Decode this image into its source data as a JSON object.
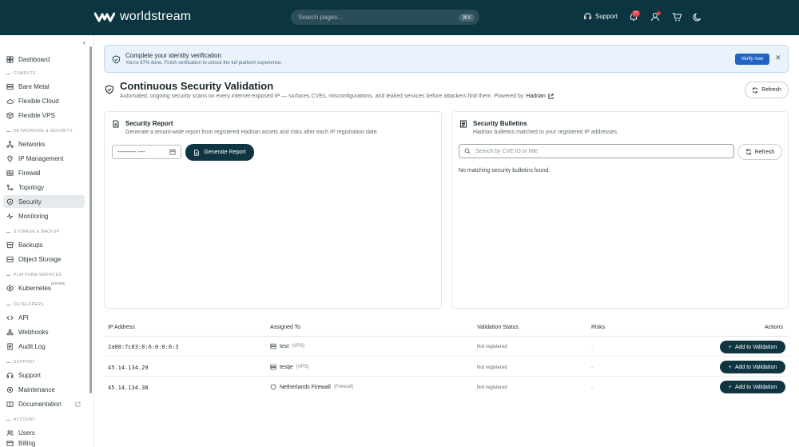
{
  "header": {
    "logo_text": "worldstream",
    "search_placeholder": "Search pages...",
    "search_shortcut": "⌘K",
    "support_label": "Support",
    "notification_count": "27"
  },
  "sidebar": {
    "items": {
      "dashboard": "Dashboard",
      "bare_metal": "Bare Metal",
      "flexible_cloud": "Flexible Cloud",
      "flexible_vps": "Flexible VPS",
      "networks": "Networks",
      "ip_management": "IP Management",
      "firewall": "Firewall",
      "topology": "Topology",
      "security": "Security",
      "monitoring": "Monitoring",
      "backups": "Backups",
      "object_storage": "Object Storage",
      "kubernetes": "Kubernetes",
      "api": "API",
      "webhooks": "Webhooks",
      "audit_log": "Audit Log",
      "support": "Support",
      "maintenance": "Maintenance",
      "documentation": "Documentation",
      "users": "Users",
      "billing": "Billing"
    },
    "sections": {
      "compute": "COMPUTE",
      "networking": "NETWORKING & SECURITY",
      "storage": "STORAGE & BACKUP",
      "platform": "PLATFORM SERVICES",
      "developers": "DEVELOPERS",
      "support": "SUPPORT",
      "account": "ACCOUNT"
    },
    "preview_tag": "preview"
  },
  "banner": {
    "title": "Complete your identity verification",
    "subtitle": "You're 67% done. Finish verification to unlock the full platform experience.",
    "verify_label": "Verify now"
  },
  "page": {
    "title": "Continuous Security Validation",
    "subtitle": "Automated, ongoing security scans on every internet-exposed IP — surfaces CVEs, misconfigurations, and leaked services before attackers find them. Powered by",
    "powered_by": "Hadrian",
    "refresh_label": "Refresh"
  },
  "report": {
    "title": "Security Report",
    "subtitle": "Generate a tenant-wide report from registered Hadrian assets and risks after each IP registration date.",
    "date_value": "---------- ----",
    "generate_label": "Generate Report"
  },
  "bulletins": {
    "title": "Security Bulletins",
    "subtitle": "Hadrian bulletins matched to your registered IP addresses.",
    "search_placeholder": "Search by CVE ID or title",
    "refresh_label": "Refresh",
    "empty_text": "No matching security bulletins found."
  },
  "table": {
    "headers": {
      "ip": "IP Address",
      "assigned": "Assigned To",
      "status": "Validation Status",
      "risks": "Risks",
      "actions": "Actions"
    },
    "rows": [
      {
        "ip": "2a00:7c83:8:6:0:0:0:3",
        "assigned": "test",
        "type": "(VPS)",
        "status": "Not registered",
        "risks": "-",
        "action": "Add to Validation"
      },
      {
        "ip": "45.14.134.29",
        "assigned": "testje",
        "type": "(VPS)",
        "status": "Not registered",
        "risks": "-",
        "action": "Add to Validation"
      },
      {
        "ip": "45.14.134.38",
        "assigned": "Netherlands Firewall",
        "type": "(Firewall)",
        "status": "Not registered",
        "risks": "-",
        "action": "Add to Validation"
      }
    ]
  },
  "colors": {
    "topbar": "#0b3540",
    "primary_button": "#0e3541",
    "verify_button": "#1f63c4",
    "banner_bg": "#eaf3fb"
  }
}
